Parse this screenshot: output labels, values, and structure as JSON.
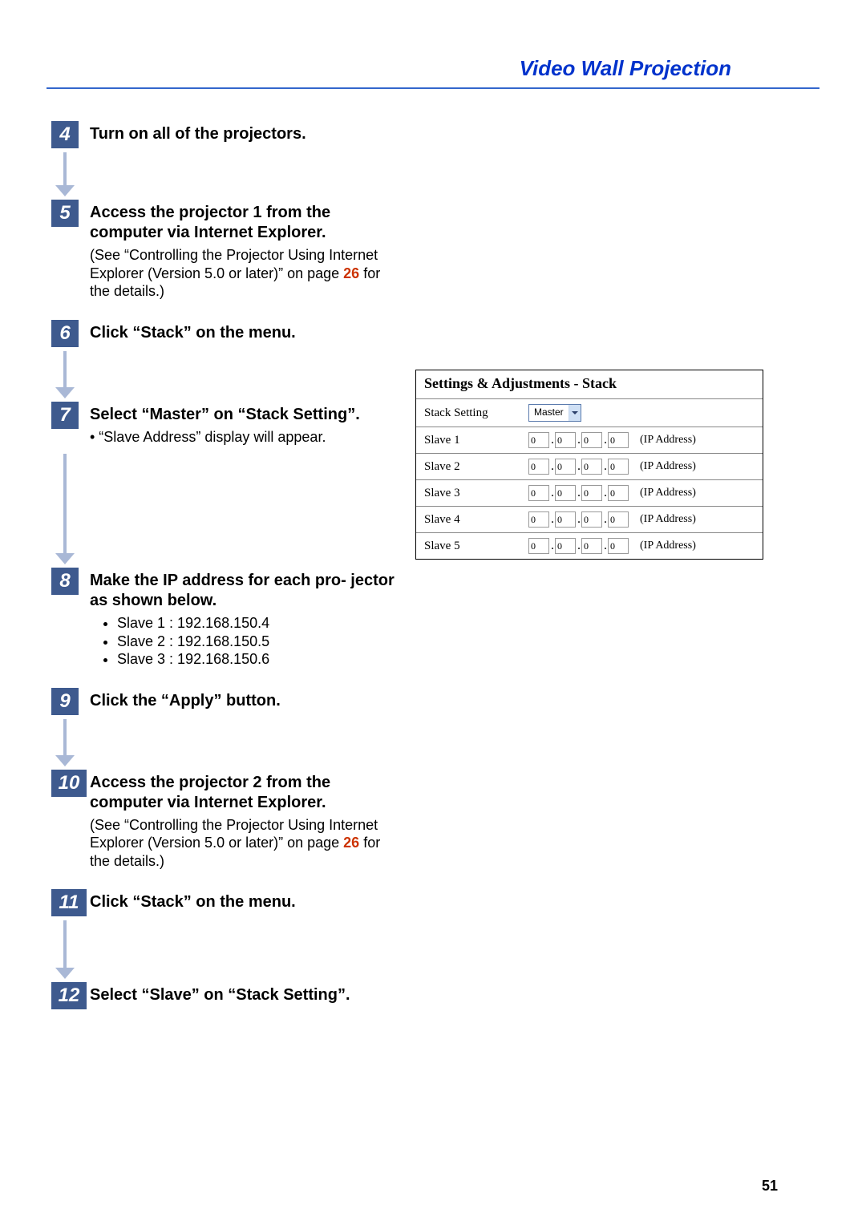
{
  "header": {
    "title": "Video Wall Projection"
  },
  "steps": [
    {
      "num": "4",
      "title": "Turn on all of the projectors.",
      "body_parts": [],
      "bullets": [],
      "connector_h": 42
    },
    {
      "num": "5",
      "title": "Access the projector 1 from the computer via Internet Explorer.",
      "body_parts": [
        {
          "pre": "(See “Controlling the Projector Using Internet Explorer (Version 5.0 or later)” on page ",
          "ref": "26",
          "post": " for the details.)"
        }
      ],
      "bullets": [],
      "connector_h": 0
    },
    {
      "num": "6",
      "title": "Click “Stack” on the menu.",
      "body_parts": [],
      "bullets": [],
      "connector_h": 46
    },
    {
      "num": "7",
      "title": "Select “Master” on “Stack Setting”.",
      "body_parts": [
        {
          "pre": "• “Slave Address” display will appear.",
          "ref": "",
          "post": ""
        }
      ],
      "bullets": [],
      "connector_h": 125
    },
    {
      "num": "8",
      "title": "Make the IP address for each pro-\njector as shown below.",
      "body_parts": [],
      "bullets": [
        "Slave 1 : 192.168.150.4",
        "Slave 2 : 192.168.150.5",
        "Slave 3 : 192.168.150.6"
      ],
      "connector_h": 0
    },
    {
      "num": "9",
      "title": "Click the “Apply” button.",
      "body_parts": [],
      "bullets": [],
      "connector_h": 46
    },
    {
      "num": "10",
      "title": "Access the projector 2 from the computer via Internet Explorer.",
      "body_parts": [
        {
          "pre": "(See “Controlling the Projector Using Internet Explorer (Version 5.0 or later)” on page ",
          "ref": "26",
          "post": " for the details.)"
        }
      ],
      "bullets": [],
      "connector_h": 0
    },
    {
      "num": "11",
      "title": "Click “Stack” on the menu.",
      "body_parts": [],
      "bullets": [],
      "connector_h": 60
    },
    {
      "num": "12",
      "title": "Select “Slave” on “Stack Setting”.",
      "body_parts": [],
      "bullets": [],
      "connector_h": 0
    }
  ],
  "panel": {
    "title": "Settings & Adjustments - Stack",
    "setting_row": {
      "label": "Stack Setting",
      "selected": "Master"
    },
    "slave_rows": [
      {
        "label": "Slave 1",
        "ip": [
          "0",
          "0",
          "0",
          "0"
        ],
        "suffix": "(IP Address)"
      },
      {
        "label": "Slave 2",
        "ip": [
          "0",
          "0",
          "0",
          "0"
        ],
        "suffix": "(IP Address)"
      },
      {
        "label": "Slave 3",
        "ip": [
          "0",
          "0",
          "0",
          "0"
        ],
        "suffix": "(IP Address)"
      },
      {
        "label": "Slave 4",
        "ip": [
          "0",
          "0",
          "0",
          "0"
        ],
        "suffix": "(IP Address)"
      },
      {
        "label": "Slave 5",
        "ip": [
          "0",
          "0",
          "0",
          "0"
        ],
        "suffix": "(IP Address)"
      }
    ]
  },
  "page_number": "51"
}
